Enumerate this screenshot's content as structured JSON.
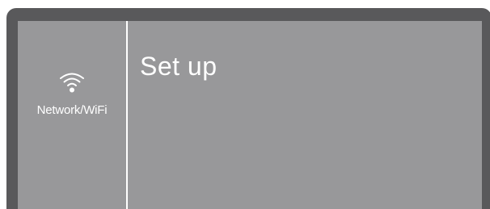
{
  "sidebar": {
    "items": [
      {
        "label": "Network/WiFi",
        "icon": "wifi-icon"
      }
    ]
  },
  "main": {
    "title": "Set up"
  },
  "colors": {
    "bezel": "#59595b",
    "screen": "#98989a",
    "text": "#ffffff",
    "divider": "#ffffff"
  }
}
